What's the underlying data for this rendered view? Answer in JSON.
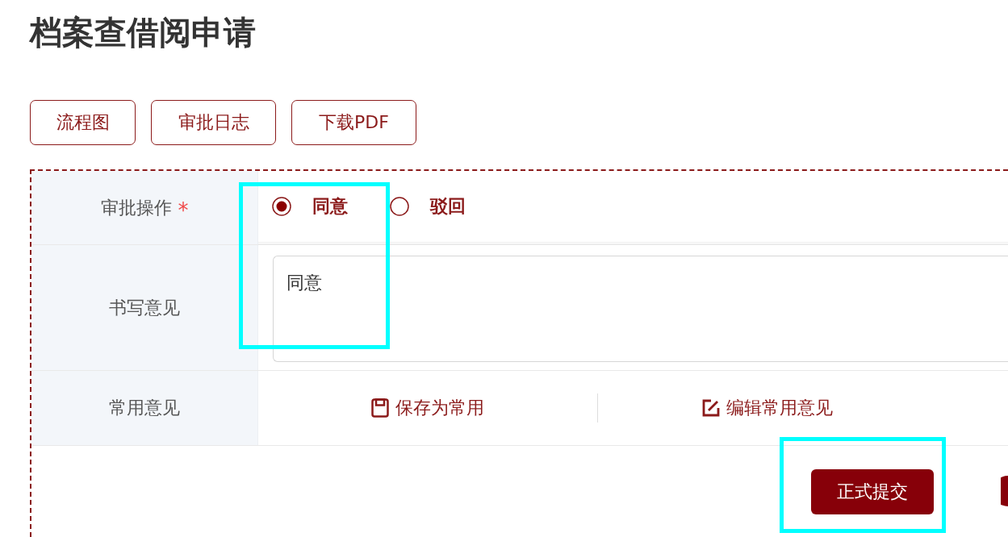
{
  "page_title": "档案查借阅申请",
  "toolbar_buttons": [
    "流程图",
    "审批日志",
    "下载PDF"
  ],
  "form": {
    "rows": [
      {
        "kind": "radio",
        "label": "审批操作",
        "required_mark": "*",
        "options": [
          {
            "label": "同意",
            "selected": true
          },
          {
            "label": "驳回",
            "selected": false
          }
        ]
      },
      {
        "kind": "textarea",
        "label": "书写意见",
        "value": "同意"
      },
      {
        "kind": "actions",
        "label": "常用意见",
        "actions": [
          {
            "kind": "save",
            "label": "保存为常用"
          },
          {
            "kind": "edit",
            "label": "编辑常用意见"
          }
        ]
      }
    ],
    "submit_button": "正式提交"
  }
}
